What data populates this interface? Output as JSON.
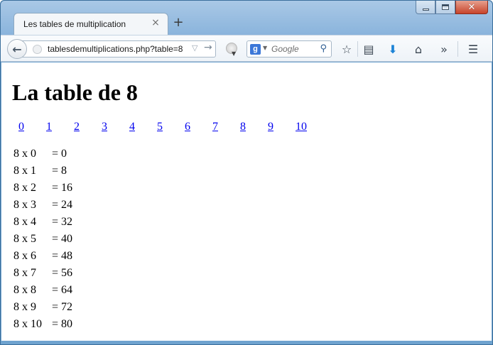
{
  "browser": {
    "tab_title": "Les tables de multiplication",
    "tab_close_icon": "close-icon",
    "new_tab_glyph": "+",
    "url": "tablesdemultiplications.php?table=8",
    "search_placeholder": "Google",
    "search_engine_letter": "g"
  },
  "page": {
    "title": "La table de 8",
    "table_links": [
      "0",
      "1",
      "2",
      "3",
      "4",
      "5",
      "6",
      "7",
      "8",
      "9",
      "10"
    ],
    "rows": [
      {
        "expr": "8 x 0",
        "result": "= 0"
      },
      {
        "expr": "8 x 1",
        "result": "= 8"
      },
      {
        "expr": "8 x 2",
        "result": "= 16"
      },
      {
        "expr": "8 x 3",
        "result": "= 24"
      },
      {
        "expr": "8 x 4",
        "result": "= 32"
      },
      {
        "expr": "8 x 5",
        "result": "= 40"
      },
      {
        "expr": "8 x 6",
        "result": "= 48"
      },
      {
        "expr": "8 x 7",
        "result": "= 56"
      },
      {
        "expr": "8 x 8",
        "result": "= 64"
      },
      {
        "expr": "8 x 9",
        "result": "= 72"
      },
      {
        "expr": "8 x 10",
        "result": "= 80"
      }
    ]
  },
  "colors": {
    "link": "#0000ee",
    "frame": "#6fa3cf"
  }
}
